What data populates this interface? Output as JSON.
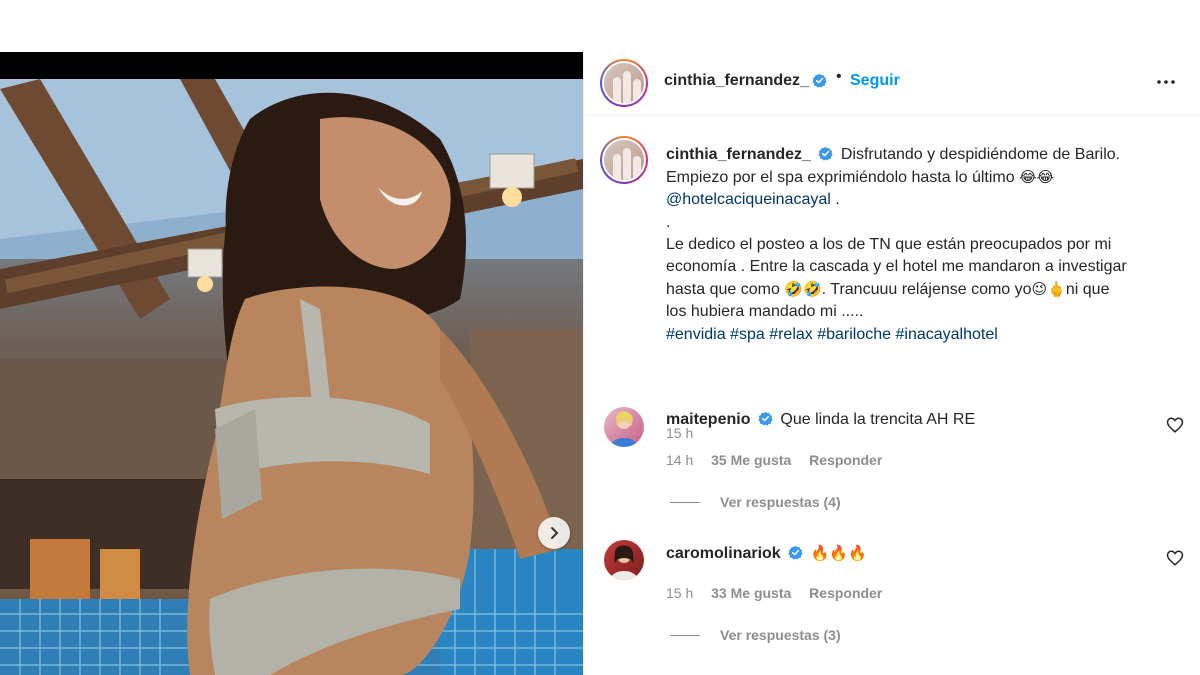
{
  "post": {
    "author": "cinthia_fernandez_",
    "follow_label": "Seguir",
    "separator": "•",
    "caption": {
      "username": "cinthia_fernandez_",
      "line1": "Disfrutando y despidiéndome de Barilo.",
      "line2": "Empiezo por el spa exprimiéndolo hasta lo último",
      "line2_emoji": "😂😂",
      "mention": "@hotelcaciqueinacayal",
      "mention_suffix": " .",
      "dot_line": ".",
      "line4": "Le dedico el posteo a los de TN que están preocupados por mi",
      "line5": "economía . Entre la cascada y el hotel me mandaron a investigar",
      "line6_a": "hasta que como ",
      "line6_emoji": "🤣🤣",
      "line6_b": ". Trancuuu relájense como yo",
      "line6_emoji2": "😉🖕",
      "line6_c": "ni que",
      "line7": "los hubiera mandado mi .....",
      "hashtags": "#envidia #spa #relax #bariloche #inacayalhotel"
    },
    "time": "15 h"
  },
  "comments": [
    {
      "username": "maitepenio",
      "text": "Que linda la trencita AH RE",
      "time": "14 h",
      "likes": "35 Me gusta",
      "reply_label": "Responder",
      "view_replies": "Ver respuestas (4)"
    },
    {
      "username": "caromolinariok",
      "text": "🔥🔥🔥",
      "time": "15 h",
      "likes": "33 Me gusta",
      "reply_label": "Responder",
      "view_replies": "Ver respuestas (3)"
    }
  ],
  "colors": {
    "link_blue": "#0095f6",
    "mention_blue": "#00376b",
    "verified_blue": "#3897f0",
    "muted_gray": "#8e8e8e",
    "text_dark": "#262626"
  },
  "icons": {
    "verified": "verified-badge-icon",
    "more": "more-options-icon",
    "heart": "heart-outline-icon",
    "carousel_next": "chevron-right-icon"
  }
}
